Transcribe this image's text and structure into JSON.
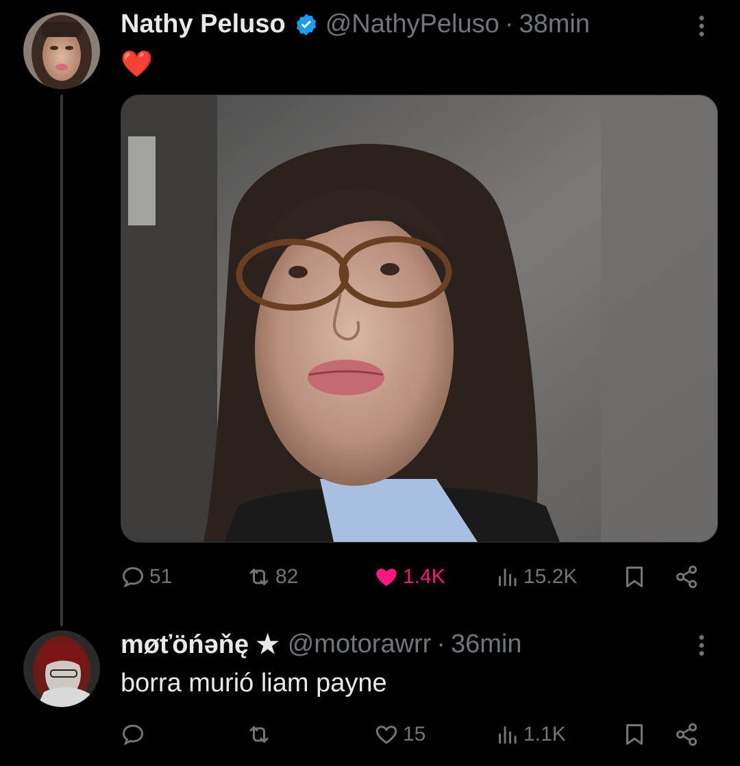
{
  "tweet1": {
    "name": "Nathy Peluso",
    "handle": "@NathyPeluso",
    "separator": "·",
    "time": "38min",
    "text": "❤️",
    "actions": {
      "replies": "51",
      "reposts": "82",
      "likes": "1.4K",
      "views": "15.2K"
    }
  },
  "tweet2": {
    "name": "møťöńəňę ★",
    "handle": "@motorawrr",
    "separator": "·",
    "time": "36min",
    "text": "borra murió liam payne",
    "actions": {
      "replies": "",
      "reposts": "",
      "likes": "15",
      "views": "1.1K"
    }
  },
  "colors": {
    "background": "#000000",
    "text_primary": "#e7e9ea",
    "text_secondary": "#71767b",
    "verified": "#1d9bf0",
    "like": "#f91880",
    "thread_line": "#333639"
  },
  "icons": [
    "reply-icon",
    "repost-icon",
    "like-icon",
    "views-icon",
    "bookmark-icon",
    "share-icon",
    "more-icon",
    "verified-badge-icon"
  ]
}
